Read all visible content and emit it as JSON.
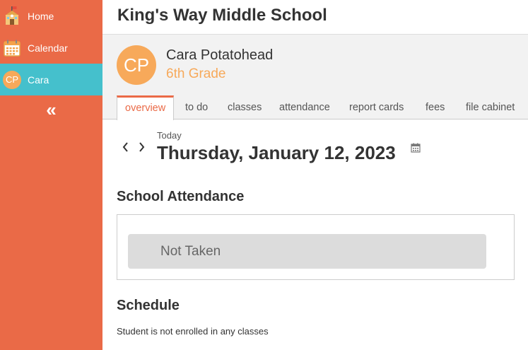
{
  "sidebar": {
    "items": [
      {
        "label": "Home",
        "icon": "school-house-icon"
      },
      {
        "label": "Calendar",
        "icon": "calendar-icon"
      },
      {
        "label": "Cara",
        "avatar_initials": "CP"
      }
    ],
    "collapse_glyph": "«"
  },
  "header": {
    "school_name": "King's Way Middle School"
  },
  "student": {
    "initials": "CP",
    "name": "Cara Potatohead",
    "grade": "6th Grade"
  },
  "tabs": [
    {
      "label": "overview",
      "active": true
    },
    {
      "label": "to do"
    },
    {
      "label": "classes"
    },
    {
      "label": "attendance"
    },
    {
      "label": "report cards"
    },
    {
      "label": "fees"
    },
    {
      "label": "file cabinet"
    }
  ],
  "date": {
    "relative_label": "Today",
    "full_date": "Thursday, January 12, 2023"
  },
  "attendance": {
    "title": "School Attendance",
    "status": "Not Taken"
  },
  "schedule": {
    "title": "Schedule",
    "note": "Student is not enrolled in any classes"
  },
  "colors": {
    "sidebar_bg": "#ea6a47",
    "sidebar_active_bg": "#45c0cc",
    "avatar_bg": "#f7a95a",
    "accent": "#ea6a47"
  }
}
